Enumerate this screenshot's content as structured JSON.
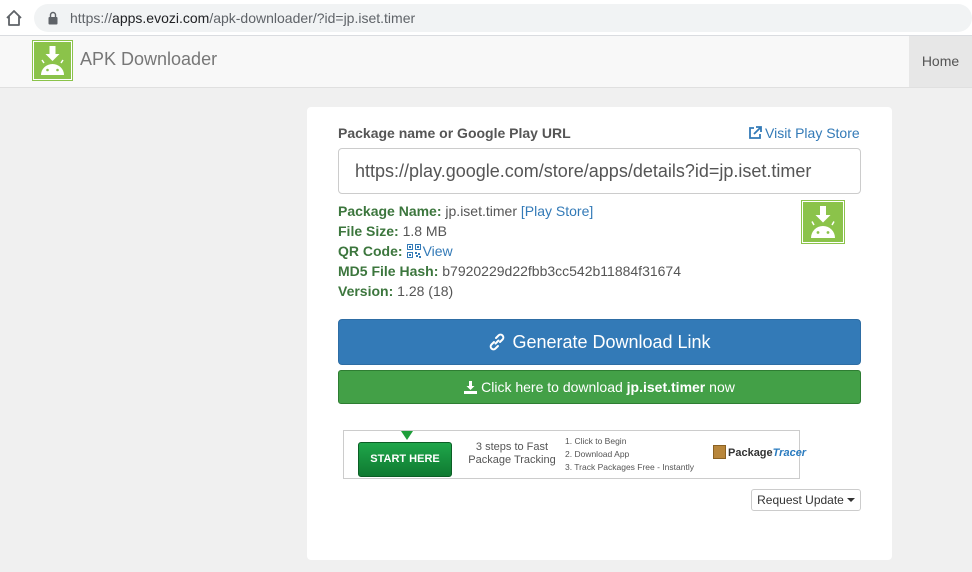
{
  "browser": {
    "url_prefix": "https://",
    "url_host": "apps.evozi.com",
    "url_path": "/apk-downloader/?id=jp.iset.timer"
  },
  "navbar": {
    "brand": "APK Downloader",
    "home": "Home"
  },
  "form": {
    "label": "Package name or Google Play URL",
    "visit_link": "Visit Play Store",
    "input_value": "https://play.google.com/store/apps/details?id=jp.iset.timer"
  },
  "info": {
    "package_name_key": "Package Name:",
    "package_name": "jp.iset.timer",
    "play_store_link": "[Play Store]",
    "file_size_key": "File Size:",
    "file_size": "1.8 MB",
    "qr_key": "QR Code:",
    "qr_view": "View",
    "md5_key": "MD5 File Hash:",
    "md5": "b7920229d22fbb3cc542b11884f31674",
    "version_key": "Version:",
    "version": "1.28 (18)"
  },
  "buttons": {
    "generate": "Generate Download Link",
    "download_prefix": "Click here to download",
    "download_pkg": "jp.iset.timer",
    "download_suffix": "now",
    "request_update": "Request Update"
  },
  "ad": {
    "start": "START HERE",
    "title": "3 steps to Fast Package Tracking",
    "step1": "1. Click to Begin",
    "step2": "2. Download App",
    "step3": "3. Track Packages Free - Instantly",
    "logo_a": "Package",
    "logo_b": "Tracer"
  },
  "colors": {
    "android_green": "#8bc34a",
    "primary_blue": "#337ab7",
    "success_green": "#43a047",
    "info_label_green": "#3c763d"
  }
}
